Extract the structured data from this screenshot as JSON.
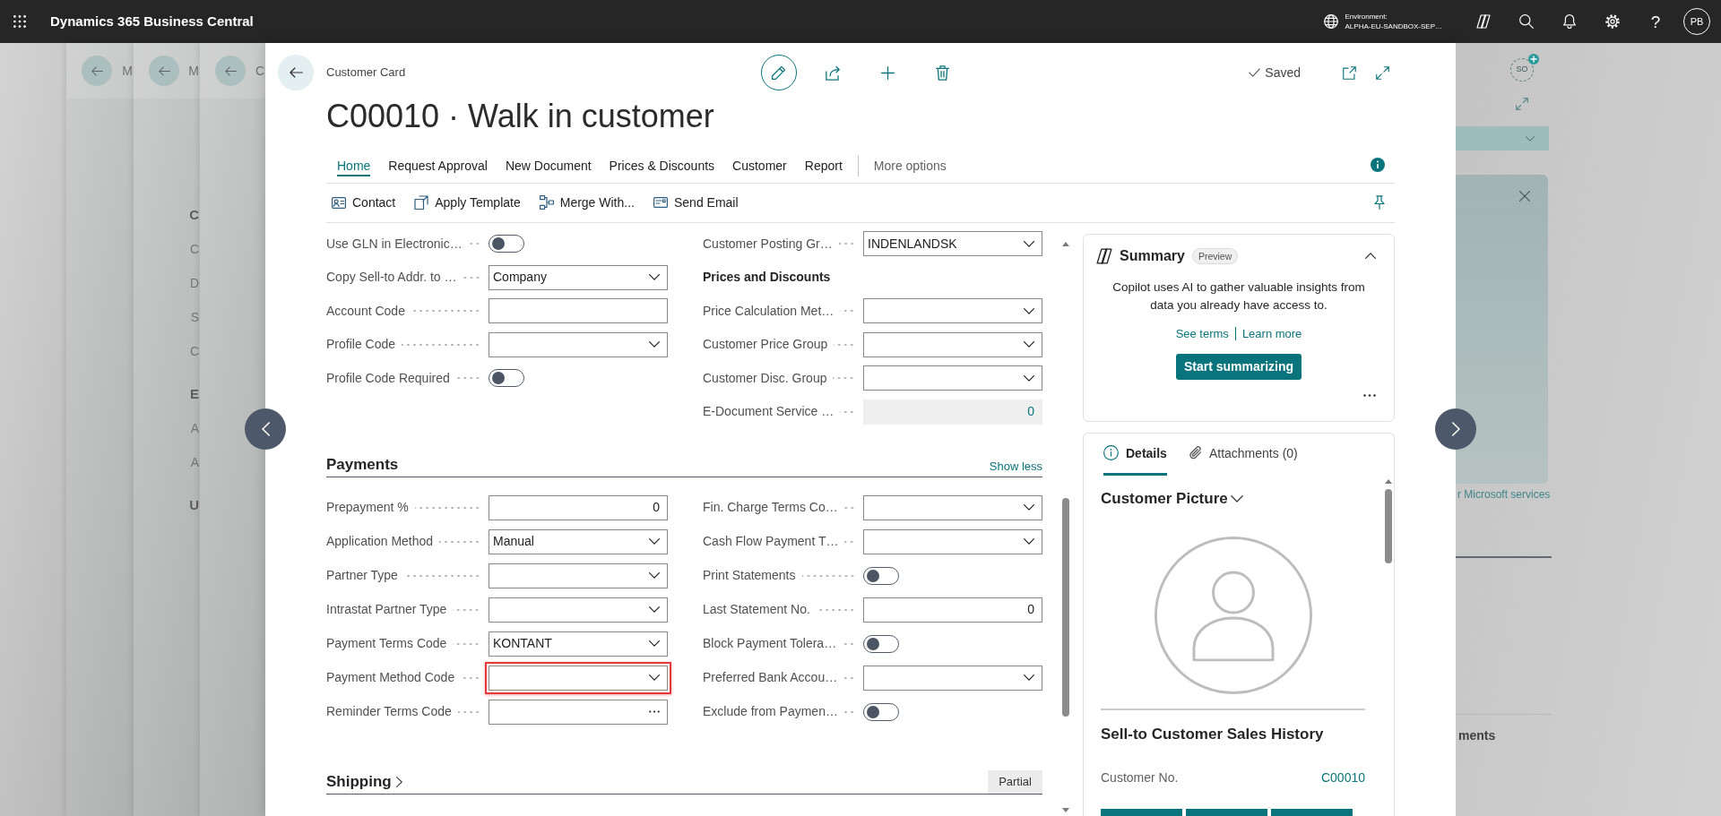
{
  "app_bar": {
    "title": "Dynamics 365 Business Central",
    "environment_label": "Environment:",
    "environment_name": "ALPHA-EU-SANDBOX-SEP…",
    "help": "?",
    "user_initials": "PB"
  },
  "background_pages": [
    {
      "caption": "M"
    },
    {
      "caption": "M",
      "items": [
        {
          "text": "C",
          "kind": "group"
        },
        {
          "text": "C",
          "kind": "field"
        },
        {
          "text": "D",
          "kind": "field"
        },
        {
          "text": "S",
          "kind": "field"
        },
        {
          "text": "C",
          "kind": "field"
        },
        {
          "text": "E",
          "kind": "group"
        },
        {
          "text": "A",
          "kind": "field"
        },
        {
          "text": "A",
          "kind": "field"
        },
        {
          "text": "U",
          "kind": "group"
        }
      ]
    },
    {
      "caption": "C"
    }
  ],
  "background_right": {
    "badge": "SO",
    "link": "r Microsoft services",
    "heading": "ments"
  },
  "dialog": {
    "breadcrumb": "Customer Card",
    "title": "C00010 · Walk in customer",
    "save_status": "Saved",
    "action_tabs": [
      {
        "label": "Home",
        "selected": true
      },
      {
        "label": "Request Approval",
        "selected": false
      },
      {
        "label": "New Document",
        "selected": false
      },
      {
        "label": "Prices & Discounts",
        "selected": false
      },
      {
        "label": "Customer",
        "selected": false
      },
      {
        "label": "Report",
        "selected": false
      }
    ],
    "more_options": "More options",
    "commands": [
      {
        "label": "Contact",
        "kind": "contact"
      },
      {
        "label": "Apply Template",
        "kind": "template"
      },
      {
        "label": "Merge With...",
        "kind": "merge"
      },
      {
        "label": "Send Email",
        "kind": "email"
      }
    ],
    "general_fields": {
      "left": [
        {
          "label": "Use GLN in Electronic…",
          "kind": "toggle",
          "on": false,
          "highlighted": false
        },
        {
          "label": "Copy Sell-to Addr. to …",
          "kind": "select",
          "value": "Company",
          "highlighted": false
        },
        {
          "label": "Account Code",
          "kind": "text",
          "highlighted": false
        },
        {
          "label": "Profile Code",
          "kind": "select",
          "highlighted": false
        },
        {
          "label": "Profile Code Required",
          "kind": "toggle",
          "on": false,
          "highlighted": false
        }
      ],
      "right": [
        {
          "label": "Customer Posting Gr…",
          "kind": "select",
          "value": "INDENLANDSK",
          "highlighted": false
        },
        {
          "label": "Prices and Discounts",
          "kind": "subheading"
        },
        {
          "label": "Price Calculation Met…",
          "kind": "select",
          "highlighted": false
        },
        {
          "label": "Customer Price Group",
          "kind": "select",
          "highlighted": false
        },
        {
          "label": "Customer Disc. Group",
          "kind": "select",
          "highlighted": false
        },
        {
          "label": "E-Document Service …",
          "kind": "readonly",
          "value": "0",
          "highlighted": false
        }
      ]
    },
    "fasttabs": [
      {
        "title": "Payments",
        "expanded": true,
        "toggle_link": "Show less",
        "left": [
          {
            "label": "Prepayment %",
            "kind": "number",
            "value": "0",
            "highlighted": false
          },
          {
            "label": "Application Method",
            "kind": "select",
            "value": "Manual",
            "highlighted": false
          },
          {
            "label": "Partner Type",
            "kind": "select",
            "highlighted": false
          },
          {
            "label": "Intrastat Partner Type",
            "kind": "select",
            "highlighted": false
          },
          {
            "label": "Payment Terms Code",
            "kind": "select",
            "value": "KONTANT",
            "highlighted": false
          },
          {
            "label": "Payment Method Code",
            "kind": "select",
            "highlighted": true
          },
          {
            "label": "Reminder Terms Code",
            "kind": "lookup",
            "highlighted": false
          }
        ],
        "right": [
          {
            "label": "Fin. Charge Terms Co…",
            "kind": "select",
            "highlighted": false
          },
          {
            "label": "Cash Flow Payment T…",
            "kind": "select",
            "highlighted": false
          },
          {
            "label": "Print Statements",
            "kind": "toggle",
            "on": false,
            "highlighted": false
          },
          {
            "label": "Last Statement No.",
            "kind": "number",
            "value": "0",
            "highlighted": false
          },
          {
            "label": "Block Payment Tolera…",
            "kind": "toggle",
            "on": false,
            "highlighted": false
          },
          {
            "label": "Preferred Bank Accou…",
            "kind": "select",
            "highlighted": false
          },
          {
            "label": "Exclude from Paymen…",
            "kind": "toggle",
            "on": false,
            "highlighted": false
          }
        ]
      },
      {
        "title": "Shipping",
        "expanded": false,
        "summary": "Partial"
      }
    ]
  },
  "factbox": {
    "summary": {
      "title": "Summary",
      "badge": "Preview",
      "expanded": true,
      "text": "Copilot uses AI to gather valuable insights from data you already have access to.",
      "links": [
        "See terms",
        "Learn more"
      ],
      "button": "Start summarizing"
    },
    "details": {
      "tabs": [
        {
          "label": "Details",
          "selected": true,
          "kind": "info"
        },
        {
          "label": "Attachments (0)",
          "selected": false,
          "kind": "attachment"
        }
      ],
      "picture_title": "Customer Picture",
      "history_title": "Sell-to Customer Sales History",
      "history_fields": [
        {
          "label": "Customer No.",
          "value": "C00010"
        }
      ]
    }
  }
}
